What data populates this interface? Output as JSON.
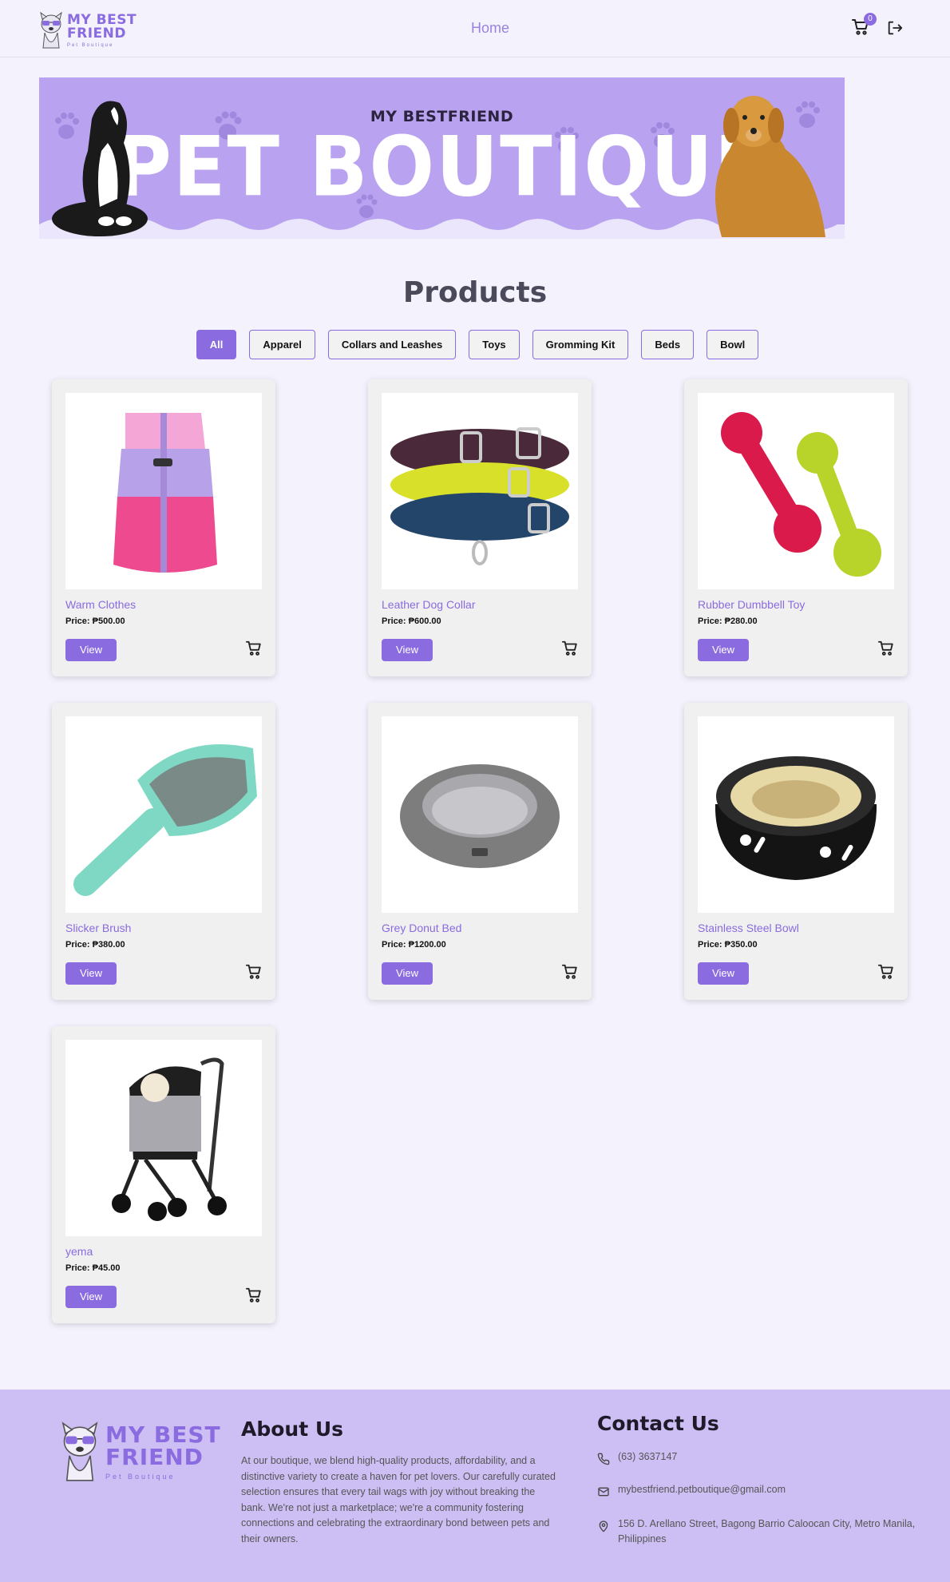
{
  "header": {
    "logo": {
      "line1": "MY BEST",
      "line2": "FRIEND",
      "line3": "Pet Boutique"
    },
    "nav_home": "Home",
    "cart_count": "0",
    "icons": {
      "cart": "cart-icon",
      "logout": "logout-icon"
    }
  },
  "banner": {
    "top": "MY BESTFRIEND",
    "main": "PET BOUTIQUE"
  },
  "products": {
    "title": "Products",
    "filters": [
      "All",
      "Apparel",
      "Collars and Leashes",
      "Toys",
      "Gromming Kit",
      "Beds",
      "Bowl"
    ],
    "active_filter": "All",
    "view_label": "View",
    "items": [
      {
        "name": "Warm Clothes",
        "price": "Price: ₱500.00"
      },
      {
        "name": "Leather Dog Collar",
        "price": "Price: ₱600.00"
      },
      {
        "name": "Rubber Dumbbell Toy",
        "price": "Price: ₱280.00"
      },
      {
        "name": "Slicker Brush",
        "price": "Price: ₱380.00"
      },
      {
        "name": "Grey Donut Bed",
        "price": "Price: ₱1200.00"
      },
      {
        "name": "Stainless Steel Bowl",
        "price": "Price: ₱350.00"
      },
      {
        "name": "yema",
        "price": "Price: ₱45.00"
      }
    ]
  },
  "footer": {
    "logo": {
      "line1": "MY BEST",
      "line2": "FRIEND",
      "line3": "Pet Boutique"
    },
    "about_title": "About Us",
    "about_text": "At our boutique, we blend high-quality products, affordability, and a distinctive variety to create a haven for pet lovers. Our carefully curated selection ensures that every tail wags with joy without breaking the bank. We're not just a marketplace; we're a community fostering connections and celebrating the extraordinary bond between pets and their owners.",
    "contact_title": "Contact Us",
    "phone": "(63) 3637147",
    "email": "mybestfriend.petboutique@gmail.com",
    "address": "156 D. Arellano Street, Bagong Barrio Caloocan City, Metro Manila, Philippines"
  },
  "colors": {
    "accent": "#8a6be0",
    "banner": "#b9a3f0",
    "footer": "#cdbff3",
    "page": "#f4f2fc"
  }
}
